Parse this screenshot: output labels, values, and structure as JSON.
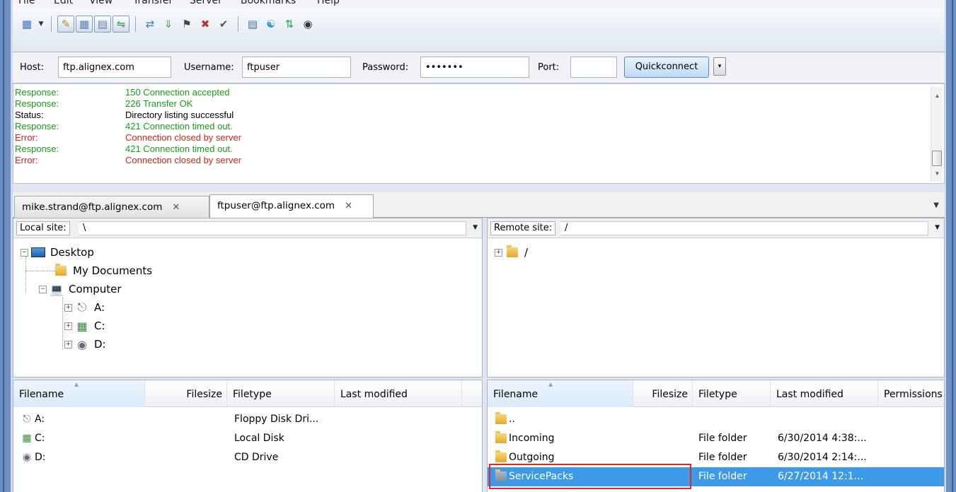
{
  "menubar": {
    "items": [
      "File",
      "Edit",
      "View",
      "Transfer",
      "Server",
      "Bookmarks",
      "Help"
    ]
  },
  "toolbar": {
    "icons": [
      "site-manager-icon",
      "dropdown-arrow-icon",
      "toggle-log-icon",
      "toggle-local-tree-icon",
      "toggle-remote-tree-icon",
      "toggle-queue-icon",
      "refresh-icon",
      "process-queue-icon",
      "cancel-operation-icon",
      "disconnect-icon",
      "reconnect-icon",
      "directory-filter-icon",
      "compare-directories-icon",
      "sync-browsing-icon",
      "search-remote-icon"
    ]
  },
  "quickconnect": {
    "host_label": "Host:",
    "host_value": "ftp.alignex.com",
    "username_label": "Username:",
    "username_value": "ftpuser",
    "password_label": "Password:",
    "password_value": "•••••••",
    "port_label": "Port:",
    "port_value": "",
    "button_label": "Quickconnect",
    "arrow": "▾"
  },
  "log": [
    {
      "type": "response",
      "key": "Response:",
      "text": "150 Connection accepted"
    },
    {
      "type": "response",
      "key": "Response:",
      "text": "226 Transfer OK"
    },
    {
      "type": "status",
      "key": "Status:",
      "text": "Directory listing successful"
    },
    {
      "type": "response",
      "key": "Response:",
      "text": "421 Connection timed out."
    },
    {
      "type": "error",
      "key": "Error:",
      "text": "Connection closed by server"
    },
    {
      "type": "response",
      "key": "Response:",
      "text": "421 Connection timed out."
    },
    {
      "type": "error",
      "key": "Error:",
      "text": "Connection closed by server"
    }
  ],
  "tabs": [
    {
      "label": "mike.strand@ftp.alignex.com",
      "close": "✕",
      "active": false
    },
    {
      "label": "ftpuser@ftp.alignex.com",
      "close": "✕",
      "active": true
    }
  ],
  "local": {
    "site_label": "Local site:",
    "site_path": "\\",
    "tree": [
      {
        "label": "Desktop",
        "toggle": "−",
        "icon": "desktop-icon"
      },
      {
        "label": "My Documents",
        "toggle": "",
        "icon": "documents-icon"
      },
      {
        "label": "Computer",
        "toggle": "−",
        "icon": "computer-icon"
      },
      {
        "label": "A:",
        "toggle": "+",
        "icon": "floppy-drive-icon"
      },
      {
        "label": "C:",
        "toggle": "+",
        "icon": "local-disk-icon"
      },
      {
        "label": "D:",
        "toggle": "+",
        "icon": "cd-drive-icon"
      }
    ],
    "columns": [
      "Filename",
      "Filesize",
      "Filetype",
      "Last modified"
    ],
    "rows": [
      {
        "name": "A:",
        "size": "",
        "type": "Floppy Disk Dri...",
        "modified": "",
        "icon": "floppy-drive-icon"
      },
      {
        "name": "C:",
        "size": "",
        "type": "Local Disk",
        "modified": "",
        "icon": "local-disk-icon"
      },
      {
        "name": "D:",
        "size": "",
        "type": "CD Drive",
        "modified": "",
        "icon": "cd-drive-icon"
      }
    ]
  },
  "remote": {
    "site_label": "Remote site:",
    "site_path": "/",
    "tree": [
      {
        "label": "/",
        "toggle": "+",
        "icon": "folder-icon"
      }
    ],
    "columns": [
      "Filename",
      "Filesize",
      "Filetype",
      "Last modified",
      "Permissions"
    ],
    "rows": [
      {
        "name": "..",
        "size": "",
        "type": "",
        "modified": "",
        "icon": "folder-icon"
      },
      {
        "name": "Incoming",
        "size": "",
        "type": "File folder",
        "modified": "6/30/2014 4:38:...",
        "icon": "folder-icon"
      },
      {
        "name": "Outgoing",
        "size": "",
        "type": "File folder",
        "modified": "6/30/2014 2:14:...",
        "icon": "folder-icon"
      },
      {
        "name": "ServicePacks",
        "size": "",
        "type": "File folder",
        "modified": "6/27/2014 12:1...",
        "icon": "folder-icon",
        "selected": true
      }
    ]
  },
  "colors": {
    "response": "#18a018",
    "error": "#d8201c",
    "selection": "#3d9ae8",
    "highlight": "#d62b2b"
  }
}
